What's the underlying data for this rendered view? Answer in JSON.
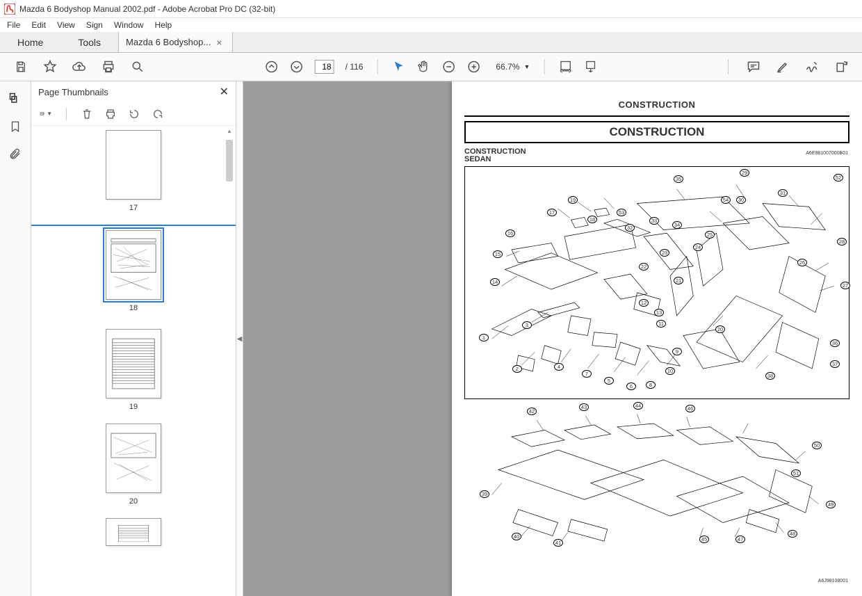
{
  "window": {
    "title": "Mazda 6 Bodyshop Manual 2002.pdf - Adobe Acrobat Pro DC (32-bit)"
  },
  "menu": [
    "File",
    "Edit",
    "View",
    "Sign",
    "Window",
    "Help"
  ],
  "tabs": {
    "home": "Home",
    "tools": "Tools",
    "doc": "Mazda 6 Bodyshop..."
  },
  "toolbar": {
    "current_page": "18",
    "total_pages": "/ 116",
    "zoom": "66.7%"
  },
  "side_panel": {
    "title": "Page Thumbnails"
  },
  "thumbnails": [
    {
      "label": "17"
    },
    {
      "label": "18"
    },
    {
      "label": "19"
    },
    {
      "label": "20"
    }
  ],
  "document": {
    "running_head": "CONSTRUCTION",
    "title_box": "CONSTRUCTION",
    "sub1": "CONSTRUCTION",
    "sub2": "SEDAN",
    "code_top": "A6E981007000B01",
    "code_bot": "A6J98108001",
    "callouts_top": [
      "1",
      "2",
      "3",
      "4",
      "5",
      "6",
      "7",
      "8",
      "9",
      "10",
      "11",
      "12",
      "13",
      "14",
      "15",
      "16",
      "17",
      "18",
      "19",
      "20",
      "21",
      "22",
      "23",
      "24",
      "25",
      "26",
      "27",
      "28",
      "29",
      "30",
      "31",
      "32",
      "33",
      "34",
      "35",
      "36",
      "37",
      "38",
      "52",
      "53",
      "54"
    ],
    "callouts_bot": [
      "39",
      "40",
      "41",
      "42",
      "43",
      "44",
      "45",
      "46",
      "47",
      "48",
      "49",
      "50",
      "51"
    ]
  }
}
